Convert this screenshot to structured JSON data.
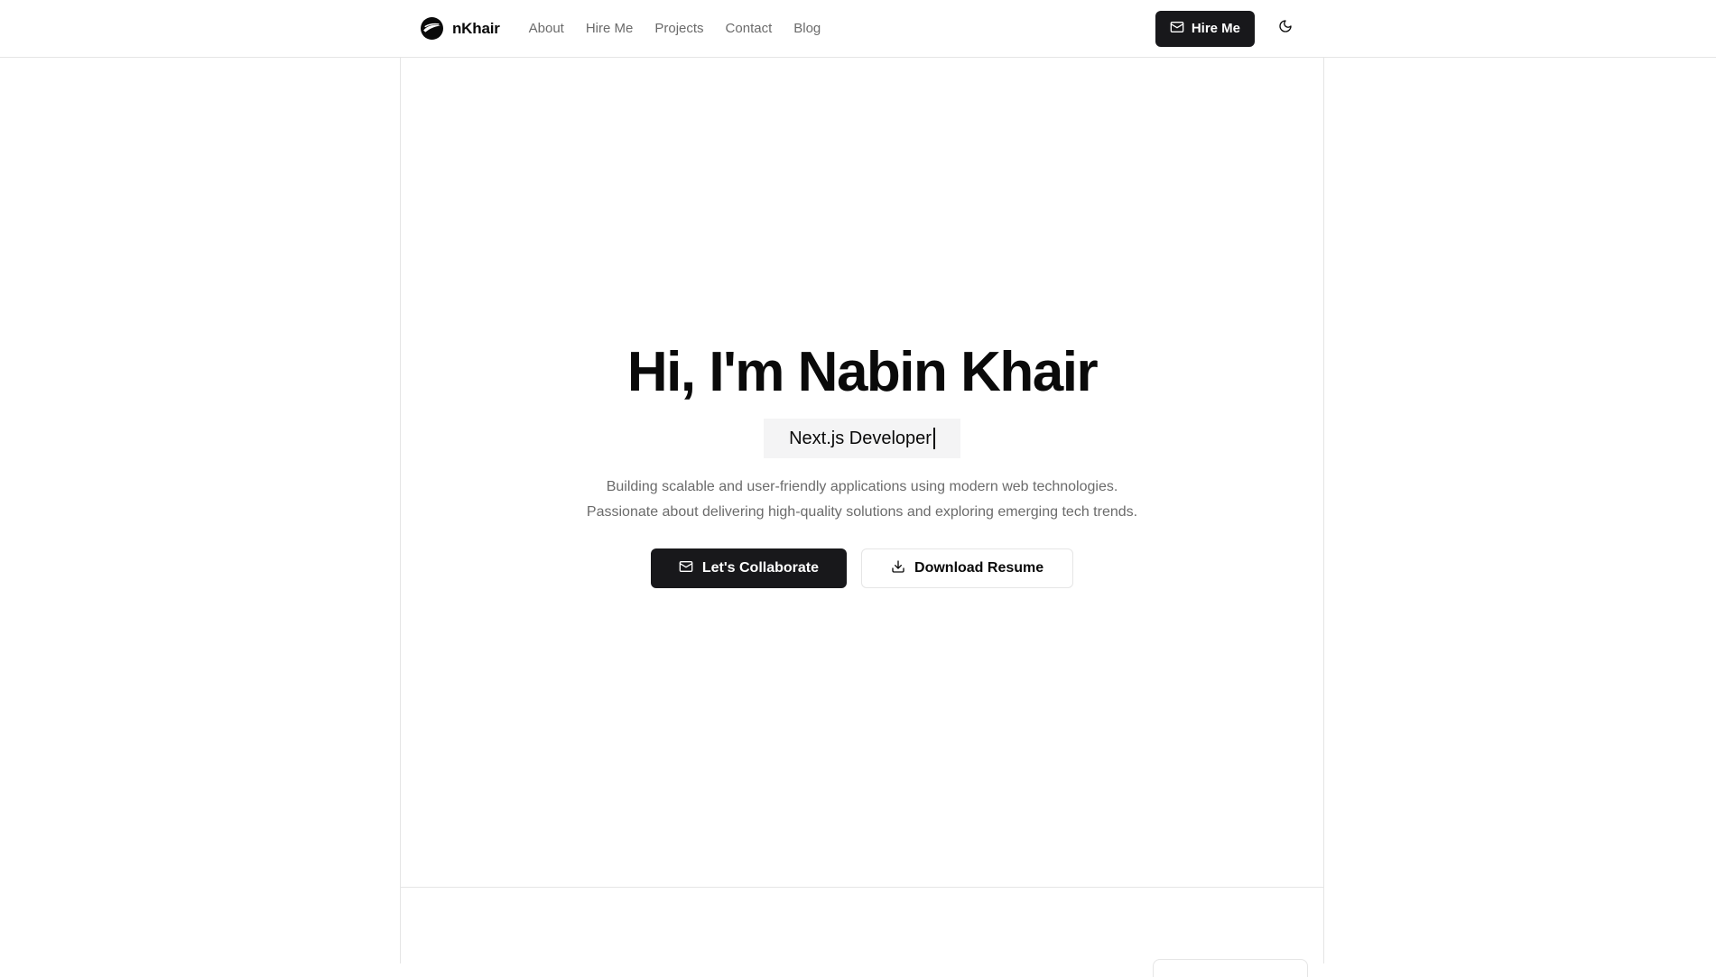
{
  "navbar": {
    "logo_text": "nKhair",
    "logo_icon": "swoosh-logo-icon",
    "links": [
      "About",
      "Hire Me",
      "Projects",
      "Contact",
      "Blog"
    ],
    "hire_button": {
      "label": "Hire Me",
      "icon": "mail-icon"
    },
    "theme_toggle_icon": "moon-icon"
  },
  "hero": {
    "title": "Hi, I'm Nabin Khair",
    "role": "Next.js Developer",
    "description_line1": "Building scalable and user-friendly applications using modern web technologies.",
    "description_line2": "Passionate about delivering high-quality solutions and exploring emerging tech trends.",
    "primary_button": {
      "label": "Let's Collaborate",
      "icon": "mail-icon"
    },
    "secondary_button": {
      "label": "Download Resume",
      "icon": "download-icon"
    }
  },
  "colors": {
    "primary": "#18181b",
    "muted_text": "#6b6b6b",
    "border": "#e5e5e5",
    "chip_background": "#f4f4f5"
  }
}
